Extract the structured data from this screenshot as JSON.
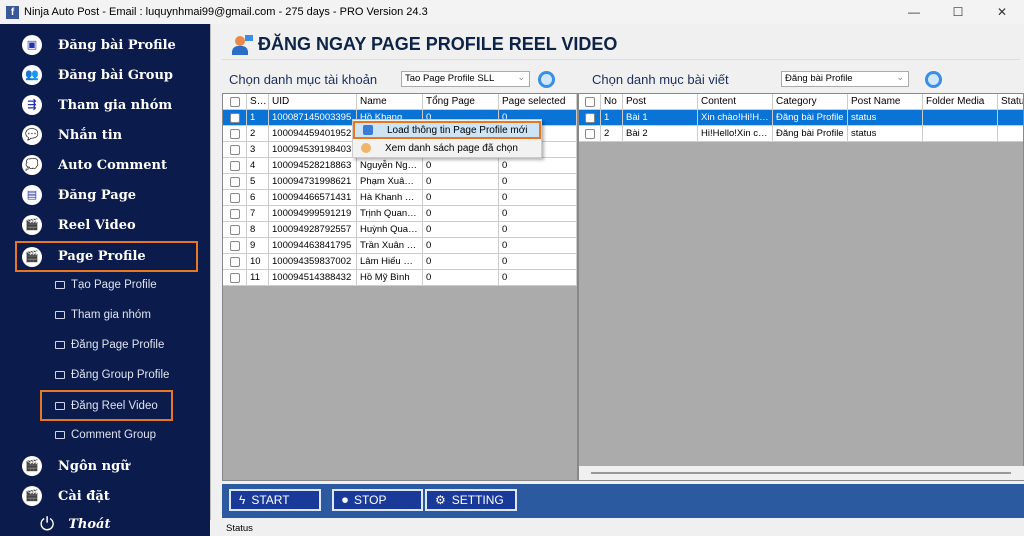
{
  "window": {
    "title": "Ninja Auto Post - Email : luquynhmai99@gmail.com - 275 days -  PRO Version 24.3",
    "controls": [
      "—",
      "☐",
      "✕"
    ]
  },
  "sidebar": {
    "items": [
      {
        "label": "Đăng bài Profile",
        "icon": "monitor-icon",
        "glyph": "▣"
      },
      {
        "label": "Đăng bài Group",
        "icon": "group-icon",
        "glyph": "👥"
      },
      {
        "label": "Tham gia nhóm",
        "icon": "share-icon",
        "glyph": "⇶"
      },
      {
        "label": "Nhắn tin",
        "icon": "chat-icon",
        "glyph": "💬"
      },
      {
        "label": "Auto Comment",
        "icon": "comment-icon",
        "glyph": "💭"
      },
      {
        "label": "Đăng Page",
        "icon": "document-icon",
        "glyph": "▤"
      },
      {
        "label": "Reel Video",
        "icon": "clapper-icon",
        "glyph": "🎬"
      },
      {
        "label": "Page Profile",
        "icon": "clapper-icon",
        "glyph": "🎬"
      }
    ],
    "subitems": [
      "Tạo Page Profile",
      "Tham gia nhóm",
      "Đăng Page Profile",
      "Đăng Group Profile",
      "Đăng Reel Video",
      "Comment Group"
    ],
    "bottom": [
      {
        "label": "Ngôn ngữ",
        "glyph": "🎬"
      },
      {
        "label": "Cài đặt",
        "glyph": "🎬"
      }
    ],
    "exit": {
      "label": "Thoát",
      "glyph": "⏻"
    },
    "highlight_color": "#e87722"
  },
  "heading": "ĐĂNG NGAY PAGE PROFILE REEL VIDEO",
  "accounts": {
    "label": "Chọn danh mục tài khoản",
    "combo": "Tao Page Profile SLL",
    "columns": [
      "",
      "STT",
      "UID",
      "Name",
      "Tổng Page",
      "Page selected"
    ],
    "rows": [
      [
        "1",
        "100087145003395",
        "Hồ Khang Ngh...",
        "0",
        "0"
      ],
      [
        "2",
        "100094459401952",
        "",
        "",
        ""
      ],
      [
        "3",
        "100094539198403",
        "",
        "",
        ""
      ],
      [
        "4",
        "100094528218863",
        "Nguyễn Nguyê...",
        "0",
        "0"
      ],
      [
        "5",
        "100094731998621",
        "Phạm Xuân Th...",
        "0",
        "0"
      ],
      [
        "6",
        "100094466571431",
        "Hà Khanh Phan",
        "0",
        "0"
      ],
      [
        "7",
        "100094999591219",
        "Trịnh Quang T...",
        "0",
        "0"
      ],
      [
        "8",
        "100094928792557",
        "Huỳnh Quang ...",
        "0",
        "0"
      ],
      [
        "9",
        "100094463841795",
        "Trần Xuân Hiếu",
        "0",
        "0"
      ],
      [
        "10",
        "100094359837002",
        "Lâm Hiếu Bông",
        "0",
        "0"
      ],
      [
        "11",
        "100094514388432",
        "Hồ Mỹ Bình",
        "0",
        "0"
      ]
    ],
    "selected_row": 0
  },
  "context_menu": [
    "Load thông tin Page Profile  mới",
    "Xem danh sách page đã chọn"
  ],
  "posts": {
    "label": "Chọn danh mục bài viết",
    "combo": "Đăng bài Profile",
    "columns": [
      "",
      "No",
      "Post",
      "Content",
      "Category",
      "Post Name",
      "Folder Media",
      "Status"
    ],
    "rows": [
      [
        "1",
        "Bài 1",
        "Xin chào!Hi!Hello!",
        "Đăng bài Profile",
        "status",
        "",
        ""
      ],
      [
        "2",
        "Bài 2",
        "Hi!Hello!Xin chào!",
        "Đăng bài Profile",
        "status",
        "",
        ""
      ]
    ],
    "selected_row": 0
  },
  "buttons": {
    "start": "START",
    "stop": "STOP",
    "setting": "SETTING"
  },
  "status": "Status",
  "colors": {
    "sidebar": "#0b1b4b",
    "selection": "#0a73d6",
    "button_bar": "#2b5aa0"
  }
}
